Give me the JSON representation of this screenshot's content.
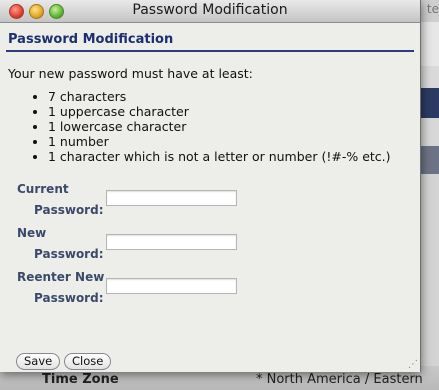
{
  "window": {
    "title": "Password Modification"
  },
  "dialog": {
    "heading": "Password Modification",
    "intro": "Your new password must have at least:",
    "rules": [
      "7 characters",
      "1 uppercase character",
      "1 lowercase character",
      "1 number",
      "1 character which is not a letter or number (!#-% etc.)"
    ],
    "fields": {
      "current": {
        "label_line1": "Current",
        "label_line2": "Password:",
        "value": ""
      },
      "new": {
        "label_line1": "New",
        "label_line2": "Password:",
        "value": ""
      },
      "reenter": {
        "label_line1": "Reenter New",
        "label_line2": "Password:",
        "value": ""
      }
    },
    "buttons": {
      "save": "Save",
      "close": "Close"
    }
  },
  "background": {
    "time_zone_label": "Time Zone",
    "time_zone_value": "* North America / Eastern",
    "edge_text": "te"
  }
}
